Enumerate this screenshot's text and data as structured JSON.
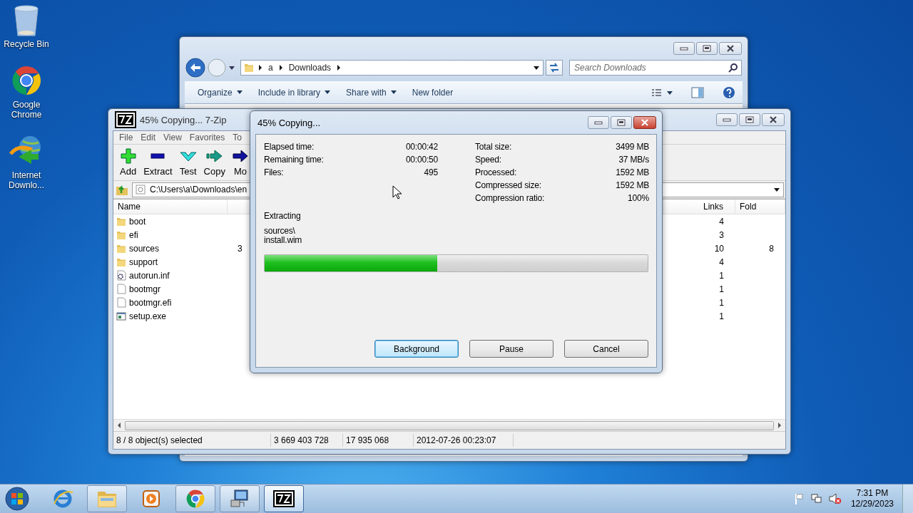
{
  "desktop_icons": [
    {
      "kind": "recycle-bin",
      "label": "Recycle Bin"
    },
    {
      "kind": "chrome",
      "label": "Google Chrome"
    },
    {
      "kind": "downloader",
      "label": "Internet Downlo..."
    }
  ],
  "explorer": {
    "path": [
      "a",
      "Downloads"
    ],
    "search": {
      "placeholder": "Search Downloads"
    },
    "commands": [
      {
        "label": "Organize",
        "dropdown": true
      },
      {
        "label": "Include in library",
        "dropdown": true
      },
      {
        "label": "Share with",
        "dropdown": true
      },
      {
        "label": "New folder",
        "dropdown": false
      }
    ]
  },
  "sevenzip": {
    "title": "45% Copying... 7-Zip",
    "menu": [
      "File",
      "Edit",
      "View",
      "Favorites",
      "To"
    ],
    "toolbar": [
      {
        "kind": "add",
        "label": "Add"
      },
      {
        "kind": "extract",
        "label": "Extract"
      },
      {
        "kind": "test",
        "label": "Test"
      },
      {
        "kind": "copy",
        "label": "Copy"
      },
      {
        "kind": "move",
        "label": "Mo"
      }
    ],
    "address": "C:\\Users\\a\\Downloads\\en",
    "columns": {
      "name": "Name",
      "links": "Links",
      "column_5": "Fold"
    },
    "rows": [
      {
        "kind": "folder",
        "name": "boot",
        "links": "4"
      },
      {
        "kind": "folder",
        "name": "efi",
        "links": "3"
      },
      {
        "kind": "folder",
        "name": "sources",
        "column_2": "3",
        "links": "10",
        "column_5": "8"
      },
      {
        "kind": "folder",
        "name": "support",
        "links": "4"
      },
      {
        "kind": "settings",
        "name": "autorun.inf",
        "links": "1"
      },
      {
        "kind": "file",
        "name": "bootmgr",
        "links": "1"
      },
      {
        "kind": "file",
        "name": "bootmgr.efi",
        "links": "1"
      },
      {
        "kind": "exe",
        "name": "setup.exe",
        "links": "1"
      }
    ],
    "status_bar": [
      "8 / 8 object(s) selected",
      "3 669 403 728",
      "17 935 068",
      "2012-07-26 00:23:07"
    ]
  },
  "dialog": {
    "title": "45% Copying...",
    "left_stats": [
      {
        "label": "Elapsed time:",
        "value": "00:00:42"
      },
      {
        "label": "Remaining time:",
        "value": "00:00:50"
      },
      {
        "label": "Files:",
        "value": "495"
      }
    ],
    "right_stats": [
      {
        "label": "Total size:",
        "value": "3499 MB"
      },
      {
        "label": "Speed:",
        "value": "37 MB/s"
      },
      {
        "label": "Processed:",
        "value": "1592 MB"
      },
      {
        "label": "Compressed size:",
        "value": "1592 MB"
      },
      {
        "label": "Compression ratio:",
        "value": "100%"
      }
    ],
    "operation": "Extracting",
    "file_lines": [
      "sources\\",
      "install.wim"
    ],
    "progress": {
      "level": 0.45
    },
    "buttons": [
      {
        "label": "Background",
        "focused": true
      },
      {
        "label": "Pause",
        "focused": false
      },
      {
        "label": "Cancel",
        "focused": false
      }
    ]
  },
  "taskbar": {
    "items": [
      {
        "kind": "ie",
        "open": false,
        "selected": false
      },
      {
        "kind": "explorer",
        "open": true,
        "selected": false
      },
      {
        "kind": "media",
        "open": false,
        "selected": false
      },
      {
        "kind": "chrome",
        "open": true,
        "selected": false
      },
      {
        "kind": "remote",
        "open": true,
        "selected": false
      },
      {
        "kind": "sevenzip",
        "open": true,
        "selected": true
      }
    ],
    "time": "7:31 PM",
    "date": "12/29/2023"
  }
}
